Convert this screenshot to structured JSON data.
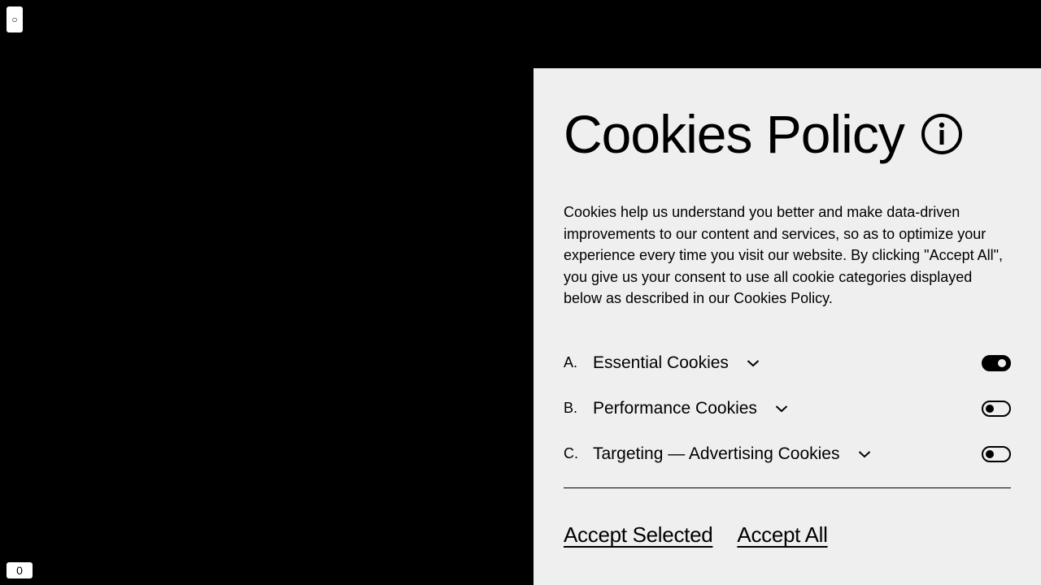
{
  "corner": {
    "top_label": "○",
    "bottom_label": "0"
  },
  "cookies": {
    "title": "Cookies Policy",
    "description": "Cookies help us understand you better and make data-driven improvements to our content and services, so as to optimize your experience every time you visit our website. By clicking \"Accept All\", you give us your consent to use all cookie categories displayed below as described in our Cookies Policy.",
    "categories": [
      {
        "letter": "A.",
        "name": "Essential Cookies",
        "enabled": true
      },
      {
        "letter": "B.",
        "name": "Performance Cookies",
        "enabled": false
      },
      {
        "letter": "C.",
        "name": "Targeting — Advertising Cookies",
        "enabled": false
      }
    ],
    "accept_selected_label": "Accept Selected",
    "accept_all_label": "Accept All"
  },
  "icons": {
    "info": "info-circle-icon",
    "chevron": "chevron-down-icon"
  },
  "colors": {
    "page_bg": "#000000",
    "panel_bg": "#efefef",
    "text": "#000000"
  }
}
